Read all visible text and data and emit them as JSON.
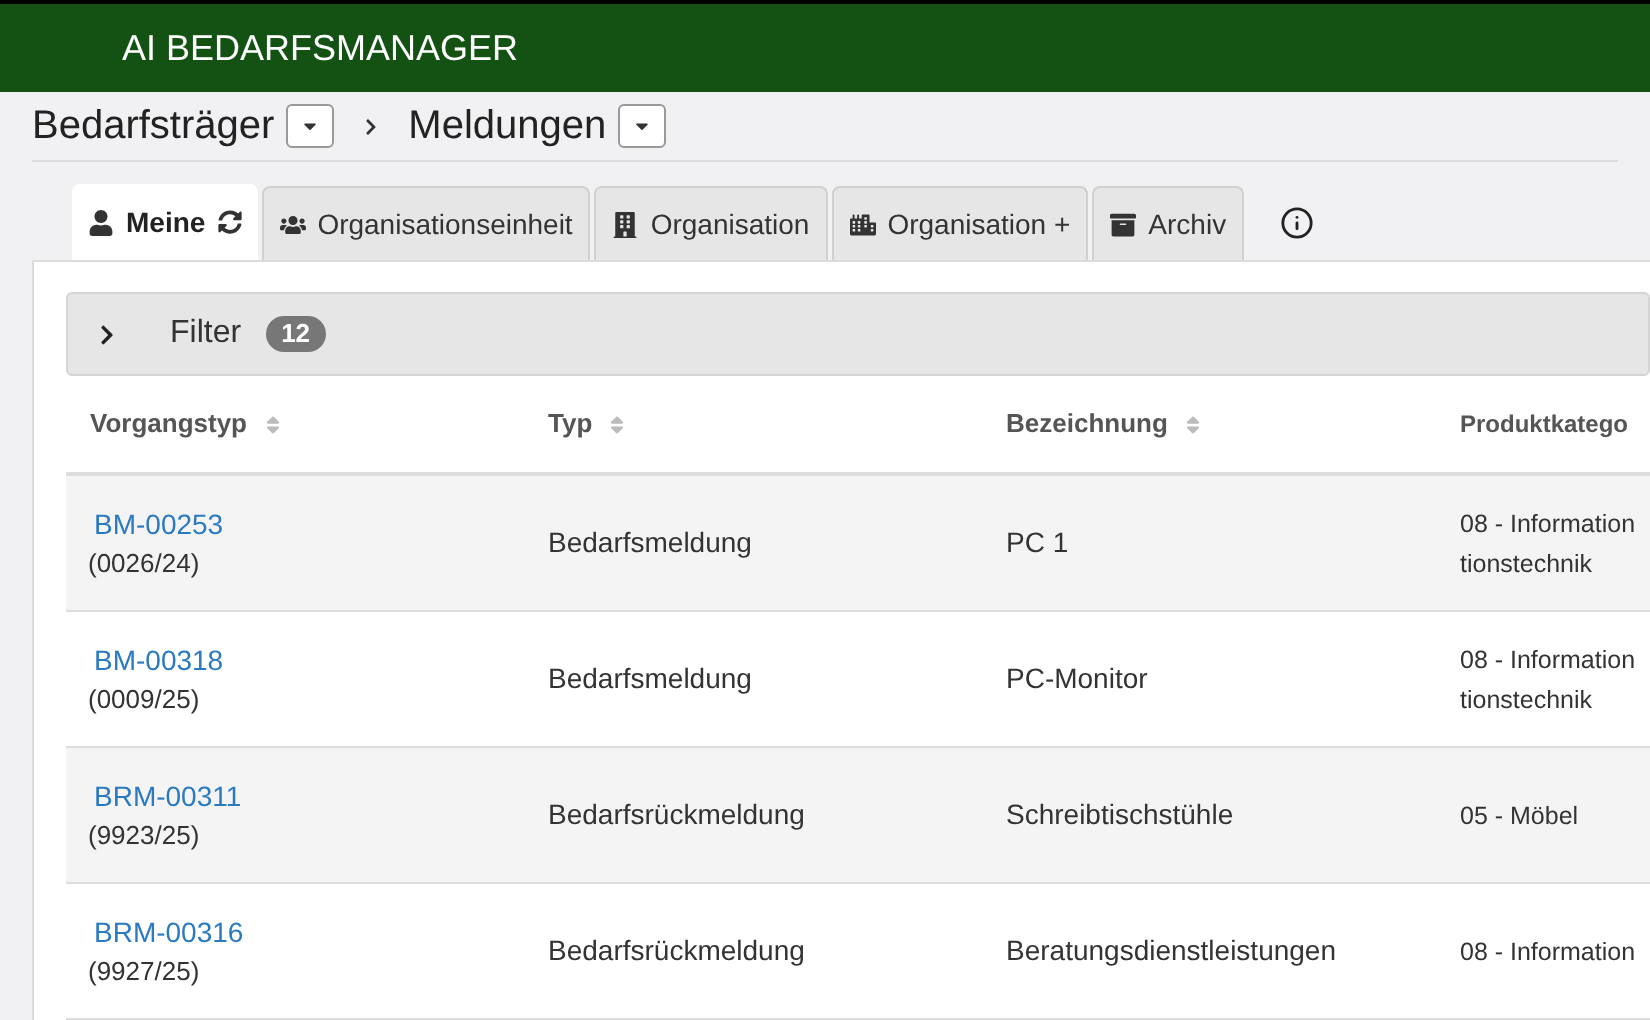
{
  "app_title": "AI BEDARFSMANAGER",
  "breadcrumb": [
    {
      "label": "Bedarfsträger"
    },
    {
      "label": "Meldungen"
    }
  ],
  "tabs": [
    {
      "label": "Meine",
      "selected": true
    },
    {
      "label": "Organisationseinheit",
      "selected": false
    },
    {
      "label": "Organisation",
      "selected": false
    },
    {
      "label": "Organisation +",
      "selected": false
    },
    {
      "label": "Archiv",
      "selected": false
    }
  ],
  "filter": {
    "label": "Filter",
    "count": "12",
    "expanded": false
  },
  "table": {
    "columns": [
      "Vorgangstyp",
      "Typ",
      "Bezeichnung",
      "Produktkatego"
    ],
    "rows": [
      {
        "id": "BM-00253",
        "number": "(0026/24)",
        "type": "Bedarfsmeldung",
        "name": "PC 1",
        "category": [
          "08 - Information",
          "tionstechnik"
        ]
      },
      {
        "id": "BM-00318",
        "number": "(0009/25)",
        "type": "Bedarfsmeldung",
        "name": "PC-Monitor",
        "category": [
          "08 - Information",
          "tionstechnik"
        ]
      },
      {
        "id": "BRM-00311",
        "number": "(9923/25)",
        "type": "Bedarfsrückmeldung",
        "name": "Schreibtischstühle",
        "category": [
          "05 - Möbel"
        ]
      },
      {
        "id": "BRM-00316",
        "number": "(9927/25)",
        "type": "Bedarfsrückmeldung",
        "name": "Beratungsdienstleistungen",
        "category": [
          "08 - Information"
        ]
      }
    ]
  }
}
